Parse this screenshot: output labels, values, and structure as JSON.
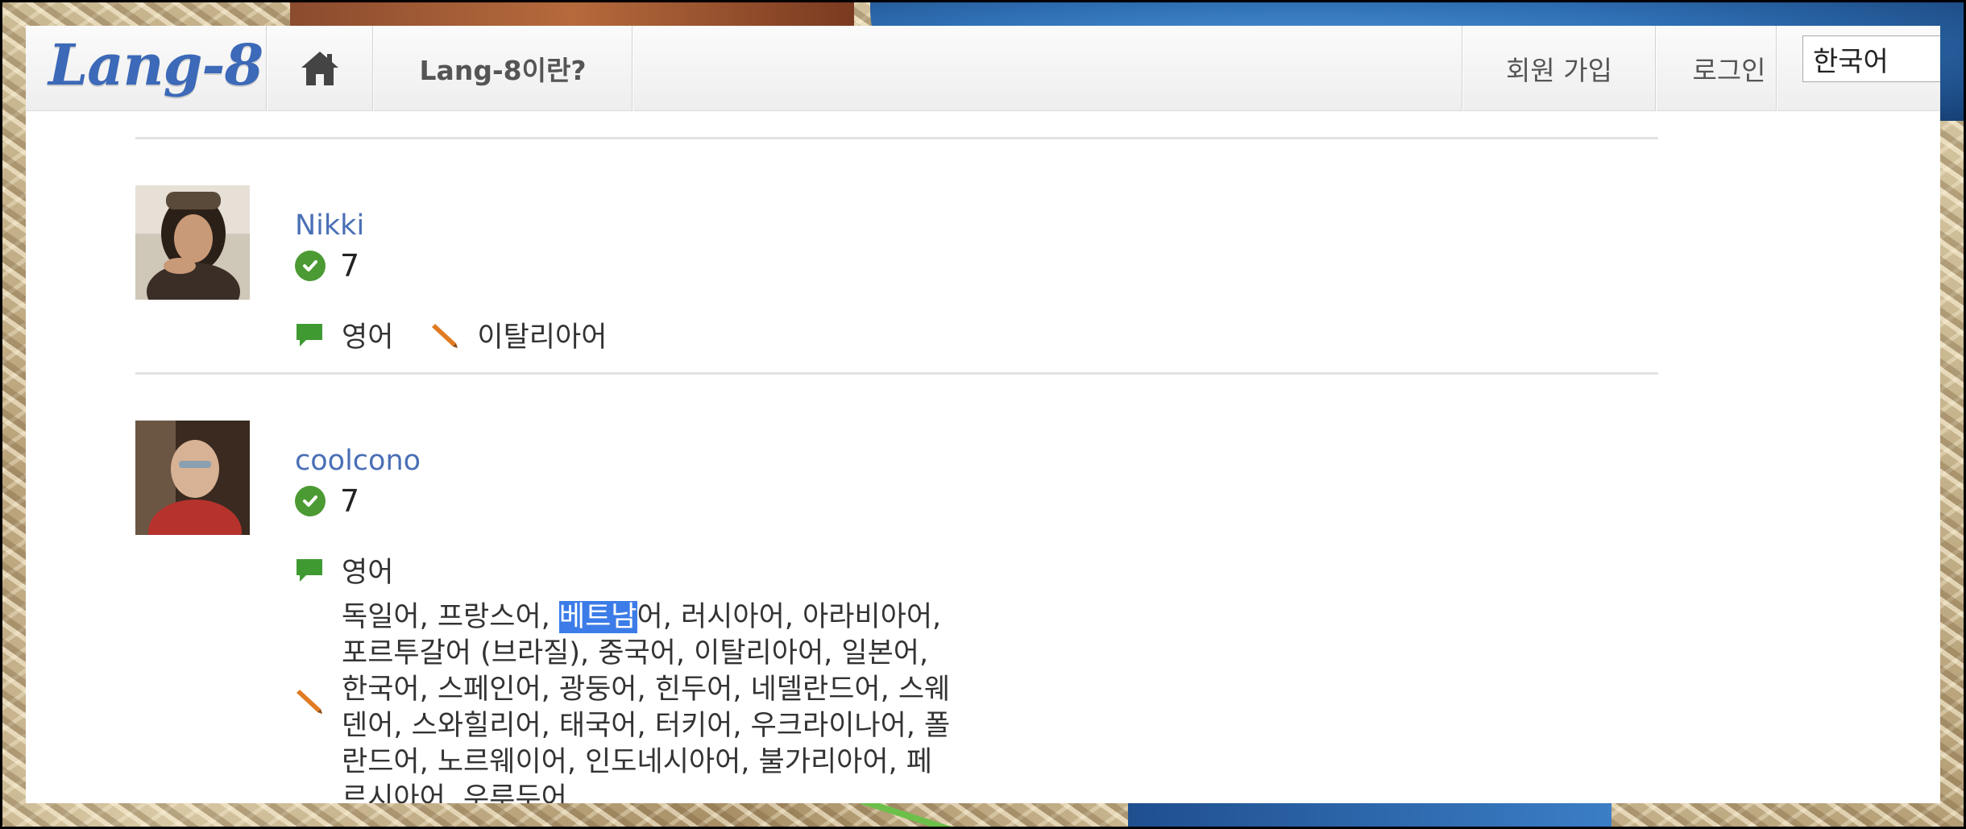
{
  "nav": {
    "logo": "Lang-8",
    "about": "Lang-8이란?",
    "signup": "회원 가입",
    "login": "로그인",
    "language_select": "한국어"
  },
  "users": [
    {
      "name": "Nikki",
      "count": "7",
      "native": "영어",
      "learning": "이탈리아어"
    },
    {
      "name": "coolcono",
      "count": "7",
      "native": "영어",
      "learning_before": "독일어, 프랑스어, ",
      "learning_highlight": "베트남",
      "learning_line1_after": "어, 러시아어, 아라비아어,",
      "learning_line2": "포르투갈어 (브라질), 중국어, 이탈리아어, 일본어,",
      "learning_line3": "한국어, 스페인어, 광둥어, 힌두어, 네델란드어, 스웨",
      "learning_line4": "덴어, 스와힐리어, 태국어, 터키어, 우크라이나어, 폴",
      "learning_line5": "란드어, 노르웨이어, 인도네시아어, 불가리아어, 페",
      "learning_line6": "르시아어, 우루두어"
    }
  ],
  "icons": {
    "home": "home-icon",
    "check": "check-circle-icon",
    "speech": "speech-bubble-icon",
    "pencil": "pencil-icon"
  },
  "colors": {
    "logo": "#3c69b8",
    "username": "#4a6fb5",
    "check": "#4b9a33",
    "speech": "#3f9a32",
    "pencil": "#e07b23",
    "highlight": "#3c7ce8"
  }
}
